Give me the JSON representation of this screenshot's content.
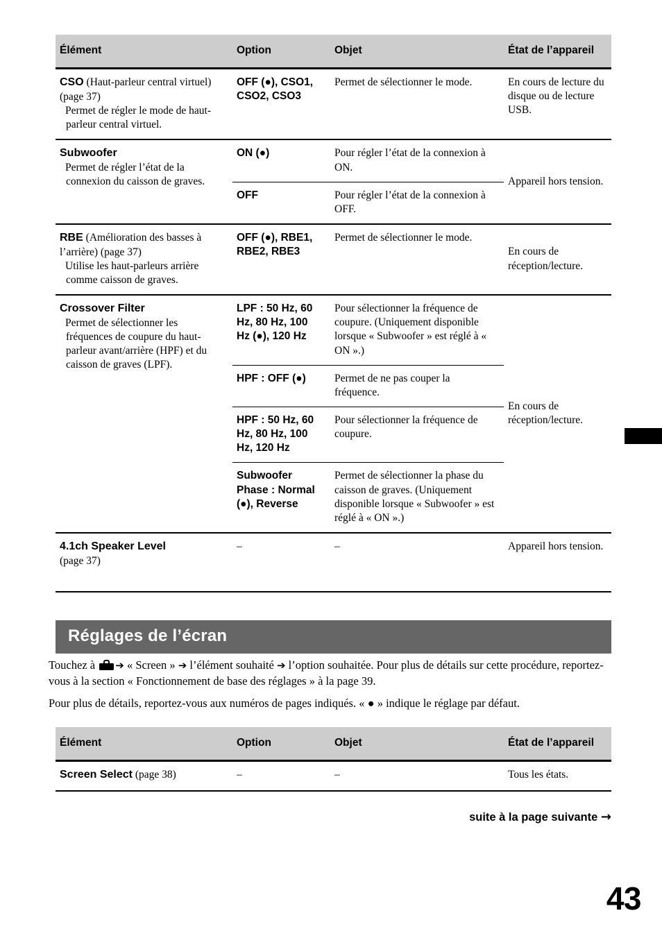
{
  "page": {
    "number": "43",
    "continued_label": "suite à la page suivante",
    "continued_arrow": "→"
  },
  "table_headers": {
    "element": "Élément",
    "option": "Option",
    "objet": "Objet",
    "etat": "État de l’appareil"
  },
  "sound_table": {
    "rows": [
      {
        "item_name": "CSO",
        "item_note": " (Haut-parleur central virtuel) (page 37)",
        "item_desc": "Permet de régler le mode de haut-parleur central virtuel.",
        "option": "OFF (●), CSO1, CSO2, CSO3",
        "objet": "Permet de sélectionner le mode.",
        "etat": "En cours de lecture du disque ou de lecture USB."
      },
      {
        "item_name": "Subwoofer",
        "item_note": "",
        "item_desc": "Permet de régler l’état de la connexion du caisson de graves.",
        "sub_rows": [
          {
            "option": "ON (●)",
            "objet": "Pour régler l’état de la connexion à ON."
          },
          {
            "option": "OFF",
            "objet": "Pour régler l’état de la connexion à OFF."
          }
        ],
        "etat": "Appareil hors tension."
      },
      {
        "item_name": "RBE",
        "item_note": " (Amélioration des basses à l’arrière) (page 37)",
        "item_desc": "Utilise les haut-parleurs arrière comme caisson de graves.",
        "option": "OFF (●), RBE1, RBE2, RBE3",
        "objet": "Permet de sélectionner le mode.",
        "etat": "En cours de réception/lecture."
      },
      {
        "item_name": "Crossover Filter",
        "item_note": "",
        "item_desc": "Permet de sélectionner les fréquences de coupure du haut-parleur avant/arrière (HPF) et du caisson de graves (LPF).",
        "sub_rows": [
          {
            "option": "LPF : 50 Hz, 60 Hz, 80 Hz, 100 Hz (●), 120 Hz",
            "objet": "Pour sélectionner la fréquence de coupure. (Uniquement disponible lorsque « Subwoofer » est réglé à « ON ».)"
          },
          {
            "option": "HPF : OFF (●)",
            "objet": "Permet de ne pas couper la fréquence."
          },
          {
            "option": "HPF : 50 Hz, 60 Hz, 80 Hz, 100 Hz, 120 Hz",
            "objet": "Pour sélectionner la fréquence de coupure."
          },
          {
            "option": "Subwoofer Phase : Normal (●), Reverse",
            "objet": "Permet de sélectionner la phase du caisson de graves. (Uniquement disponible lorsque « Subwoofer » est réglé à « ON ».)"
          }
        ],
        "etat": "En cours de réception/lecture."
      },
      {
        "item_name": "4.1ch Speaker Level",
        "item_note": "",
        "item_page": "(page 37)",
        "option": "–",
        "objet": "–",
        "etat": "Appareil hors tension."
      }
    ]
  },
  "screen_section": {
    "title": "Réglages de l’écran",
    "intro_part1": "Touchez à ",
    "intro_part2": " « Screen » ",
    "intro_part3": " l’élément souhaité ",
    "intro_part4": " l’option souhaitée. Pour plus de détails sur cette procédure, reportez-vous à la section « Fonctionnement de base des réglages » à la page 39.",
    "arrow": "➔",
    "note": "Pour plus de détails, reportez-vous aux numéros de pages indiqués. « ● » indique le réglage par défaut.",
    "table": {
      "rows": [
        {
          "item_name": "Screen Select",
          "item_note": " (page 38)",
          "option": "–",
          "objet": "–",
          "etat": "Tous les états."
        }
      ]
    }
  },
  "colors": {
    "header_gray": "#cdcdcd",
    "section_bar_gray": "#666666",
    "text": "#000000"
  }
}
